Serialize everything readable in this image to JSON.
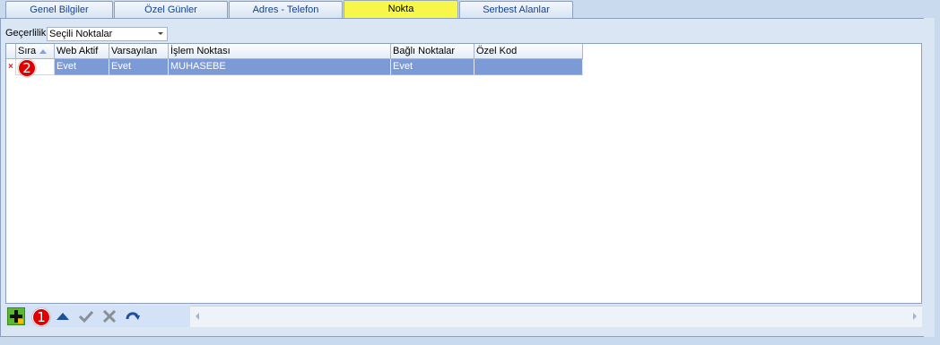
{
  "tabs": [
    {
      "label": "Genel Bilgiler"
    },
    {
      "label": "Özel Günler"
    },
    {
      "label": "Adres - Telefon"
    },
    {
      "label": "Nokta"
    },
    {
      "label": "Serbest Alanlar"
    }
  ],
  "active_tab": "Nokta",
  "filter": {
    "label": "Geçerlilik",
    "value": "Seçili Noktalar"
  },
  "grid": {
    "columns": [
      "Sıra",
      "Web Aktif",
      "Varsayılan",
      "İşlem Noktası",
      "Bağlı Noktalar",
      "Özel Kod"
    ],
    "sort_column": "Sıra",
    "sort_direction": "ascending",
    "rows": [
      {
        "sira": "",
        "web_aktif": "Evet",
        "varsayilan": "Evet",
        "islem_noktasi": "MUHASEBE",
        "bagli_noktalar": "Evet",
        "ozel_kod": ""
      }
    ]
  },
  "annotations": {
    "badge_1": "1",
    "badge_2": "2"
  },
  "navigator": {
    "buttons": [
      "add-icon",
      "move-up-icon",
      "confirm-check-icon",
      "cancel-x-icon",
      "refresh-icon"
    ]
  },
  "colors": {
    "active_tab": "#f7f74a",
    "selected_row": "#7b9ad6",
    "badge": "#e10000",
    "panel": "#dbe6f4"
  }
}
